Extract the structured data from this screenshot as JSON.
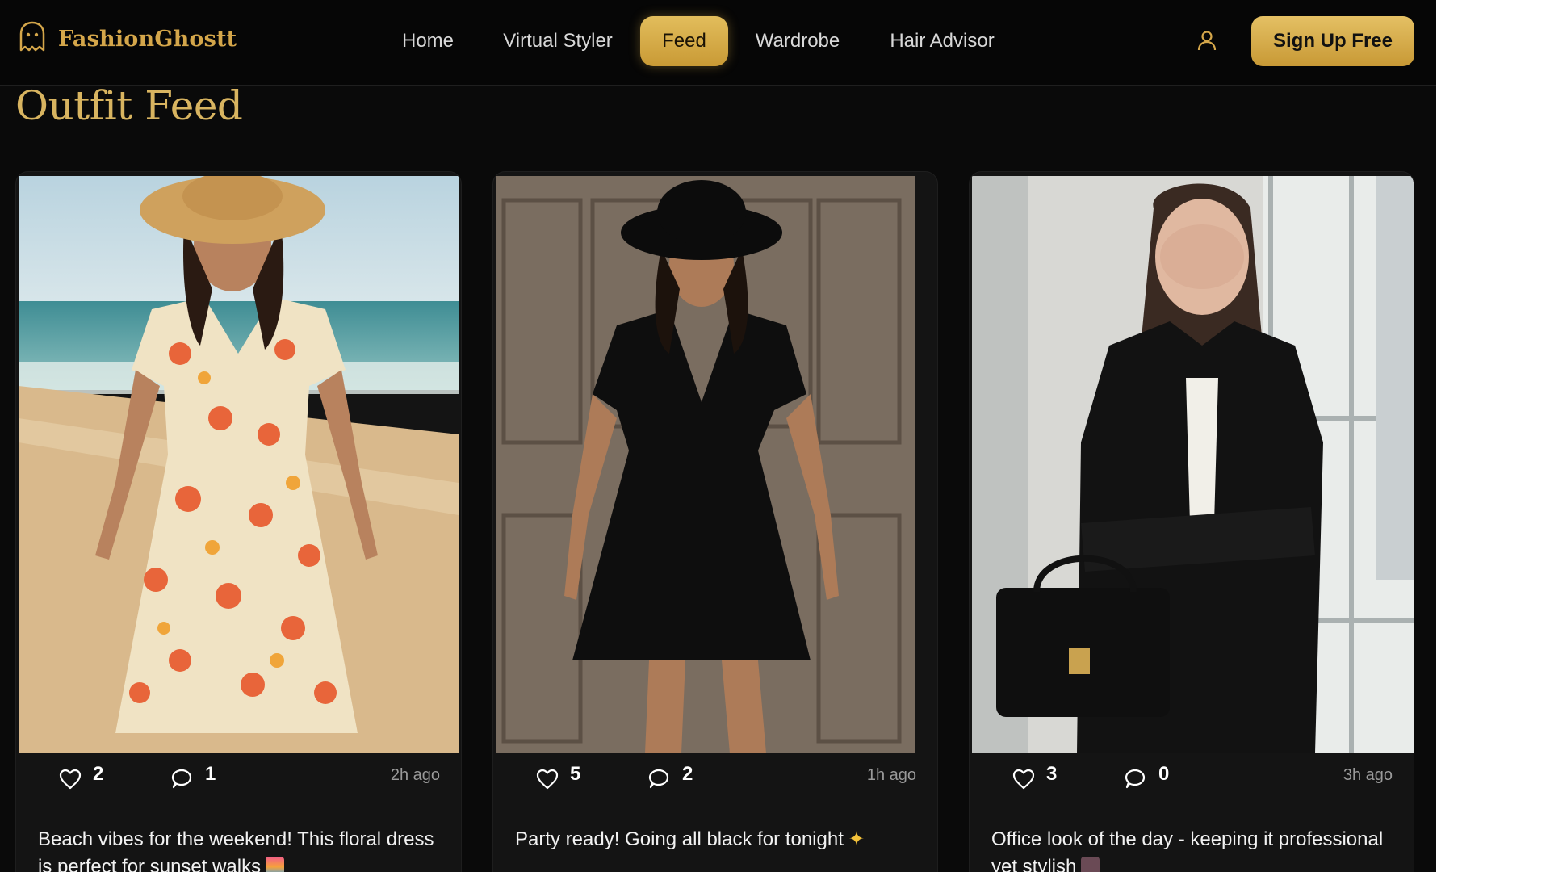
{
  "brand": {
    "name": "FashionGhostt",
    "logo_icon": "ghost-icon",
    "accent": "#d4a64a"
  },
  "nav": {
    "items": [
      {
        "label": "Home",
        "active": false
      },
      {
        "label": "Virtual Styler",
        "active": false
      },
      {
        "label": "Feed",
        "active": true
      },
      {
        "label": "Wardrobe",
        "active": false
      },
      {
        "label": "Hair Advisor",
        "active": false
      }
    ],
    "profile_icon": "user-icon",
    "signup_label": "Sign Up Free"
  },
  "page": {
    "title": "Outfit Feed"
  },
  "posts": [
    {
      "likes": "2",
      "comments": "1",
      "time": "2h ago",
      "caption": "Beach vibes for the weekend! This floral dress is perfect for sunset walks",
      "emoji": "🌅"
    },
    {
      "likes": "5",
      "comments": "2",
      "time": "1h ago",
      "caption": "Party ready! Going all black for tonight",
      "emoji": "✨"
    },
    {
      "likes": "3",
      "comments": "0",
      "time": "3h ago",
      "caption": "Office look of the day - keeping it professional yet stylish",
      "emoji": "💼"
    }
  ],
  "colors": {
    "background": "#0a0a0a",
    "card": "#141414",
    "gold": "#d4a64a",
    "muted": "#9a9a9a"
  }
}
